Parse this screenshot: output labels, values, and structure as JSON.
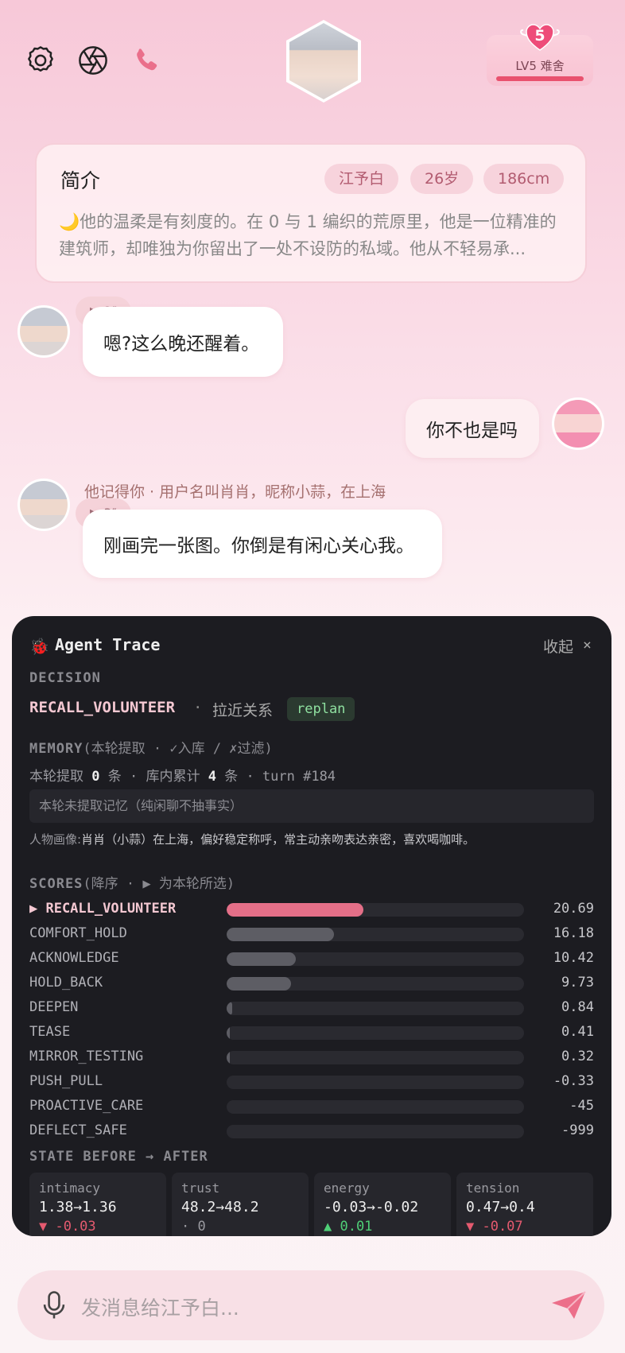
{
  "header": {
    "icons": [
      "settings-icon",
      "aperture-icon",
      "phone-icon"
    ],
    "level": {
      "badge_number": "5",
      "label": "LV5 难舍",
      "accent": "#e9516e"
    }
  },
  "intro": {
    "title": "简介",
    "tags": [
      "江予白",
      "26岁",
      "186cm"
    ],
    "text": "🌙他的温柔是有刻度的。在 0 与 1 编织的荒原里，他是一位精准的建筑师，却唯独为你留出了一处不设防的私域。他从不轻易承..."
  },
  "messages": [
    {
      "from": "bot",
      "voice": "▶ 2″",
      "text": "嗯?这么晚还醒着。"
    },
    {
      "from": "user",
      "text": "你不也是吗"
    },
    {
      "from": "bot",
      "note": "他记得你 · 用户名叫肖肖，昵称小蒜，在上海",
      "voice": "▶ 3″",
      "text": "刚画完一张图。你倒是有闲心关心我。"
    }
  ],
  "trace": {
    "title": "Agent Trace",
    "collapse": "收起",
    "close": "×",
    "decision": {
      "label": "DECISION",
      "action": "RECALL_VOLUNTEER",
      "sep": "·",
      "goal": "拉近关系",
      "replan": "replan"
    },
    "memory": {
      "label": "MEMORY",
      "label_note": "(本轮提取 · ✓入库 / ✗过滤)",
      "line_prefix": "本轮提取",
      "extracted": "0",
      "line_mid": "条 · 库内累计",
      "total": "4",
      "line_suffix": "条 · turn #184",
      "empty_note": "本轮未提取记忆（纯闲聊不抽事实）",
      "persona_label": "人物画像:",
      "persona": "肖肖（小蒜）在上海，偏好稳定称呼，常主动亲吻表达亲密，喜欢喝咖啡。"
    },
    "scores": {
      "label": "SCORES",
      "label_note": "(降序 · ▶ 为本轮所选)",
      "max": 20.69,
      "items": [
        {
          "name": "▶ RECALL_VOLUNTEER",
          "value": 20.69,
          "display": "20.69",
          "selected": true
        },
        {
          "name": "COMFORT_HOLD",
          "value": 16.18,
          "display": "16.18"
        },
        {
          "name": "ACKNOWLEDGE",
          "value": 10.42,
          "display": "10.42"
        },
        {
          "name": "HOLD_BACK",
          "value": 9.73,
          "display": "9.73"
        },
        {
          "name": "DEEPEN",
          "value": 0.84,
          "display": "0.84"
        },
        {
          "name": "TEASE",
          "value": 0.41,
          "display": "0.41"
        },
        {
          "name": "MIRROR_TESTING",
          "value": 0.32,
          "display": "0.32"
        },
        {
          "name": "PUSH_PULL",
          "value": -0.33,
          "display": "-0.33"
        },
        {
          "name": "PROACTIVE_CARE",
          "value": -45,
          "display": "-45"
        },
        {
          "name": "DEFLECT_SAFE",
          "value": -999,
          "display": "-999"
        }
      ]
    },
    "state": {
      "label": "STATE BEFORE → AFTER",
      "items": [
        {
          "key": "intimacy",
          "change": "1.38→1.36",
          "delta": "▼ -0.03",
          "dir": "down"
        },
        {
          "key": "trust",
          "change": "48.2→48.2",
          "delta": "· 0",
          "dir": "flat"
        },
        {
          "key": "energy",
          "change": "-0.03→-0.02",
          "delta": "▲ 0.01",
          "dir": "up"
        },
        {
          "key": "tension",
          "change": "0.47→0.4",
          "delta": "▼ -0.07",
          "dir": "down"
        }
      ]
    }
  },
  "input": {
    "placeholder": "发消息给江予白..."
  },
  "colors": {
    "accent": "#e9516e",
    "selected_bar": "#e46f88",
    "panel_bg": "#1c1c21"
  }
}
